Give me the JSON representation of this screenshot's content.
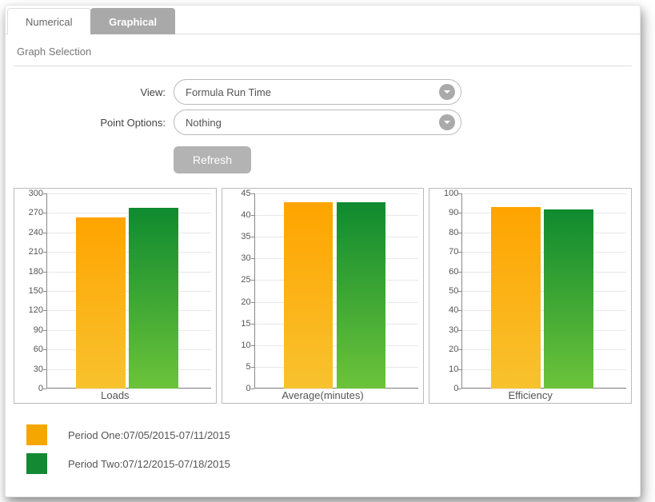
{
  "tabs": {
    "numerical": "Numerical",
    "graphical": "Graphical"
  },
  "section": "Graph Selection",
  "form": {
    "view_label": "View:",
    "view_value": "Formula Run Time",
    "point_label": "Point Options:",
    "point_value": "Nothing",
    "refresh": "Refresh"
  },
  "legend": {
    "period1": "Period One:07/05/2015-07/11/2015",
    "period2": "Period Two:07/12/2015-07/18/2015"
  },
  "chart_data": [
    {
      "type": "bar",
      "title": "Loads",
      "categories": [
        "Period One",
        "Period Two"
      ],
      "values": [
        263,
        278
      ],
      "ylim": [
        0,
        300
      ],
      "ystep": 30,
      "xlabel": "Loads",
      "ylabel": ""
    },
    {
      "type": "bar",
      "title": "Average(minutes)",
      "categories": [
        "Period One",
        "Period Two"
      ],
      "values": [
        43,
        43
      ],
      "ylim": [
        0,
        45
      ],
      "ystep": 5,
      "xlabel": "Average(minutes)",
      "ylabel": ""
    },
    {
      "type": "bar",
      "title": "Efficiency",
      "categories": [
        "Period One",
        "Period Two"
      ],
      "values": [
        93,
        92
      ],
      "ylim": [
        0,
        100
      ],
      "ystep": 10,
      "xlabel": "Efficiency",
      "ylabel": ""
    }
  ],
  "colors": {
    "series1": "#f6a600",
    "series2": "#128a33"
  }
}
